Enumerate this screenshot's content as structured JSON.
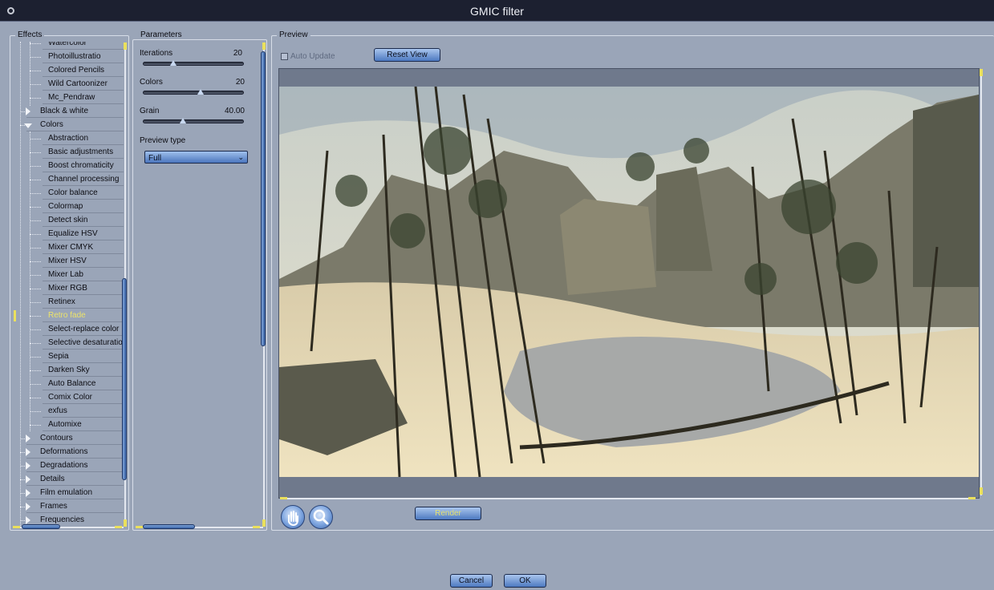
{
  "window": {
    "title": "GMIC filter"
  },
  "effects": {
    "label": "Effects",
    "items": [
      {
        "label": "Watercolor",
        "kind": "child"
      },
      {
        "label": "Photoillustratio",
        "kind": "child"
      },
      {
        "label": "Colored Pencils",
        "kind": "child"
      },
      {
        "label": "Wild Cartoonizer",
        "kind": "child"
      },
      {
        "label": "Mc_Pendraw",
        "kind": "child"
      },
      {
        "label": "Black & white",
        "kind": "parent",
        "expanded": false
      },
      {
        "label": "Colors",
        "kind": "parent",
        "expanded": true
      },
      {
        "label": "Abstraction",
        "kind": "child"
      },
      {
        "label": "Basic adjustments",
        "kind": "child"
      },
      {
        "label": "Boost chromaticity",
        "kind": "child"
      },
      {
        "label": "Channel processing",
        "kind": "child"
      },
      {
        "label": "Color balance",
        "kind": "child"
      },
      {
        "label": "Colormap",
        "kind": "child"
      },
      {
        "label": "Detect skin",
        "kind": "child"
      },
      {
        "label": "Equalize HSV",
        "kind": "child"
      },
      {
        "label": "Mixer CMYK",
        "kind": "child"
      },
      {
        "label": "Mixer HSV",
        "kind": "child"
      },
      {
        "label": "Mixer Lab",
        "kind": "child"
      },
      {
        "label": "Mixer RGB",
        "kind": "child"
      },
      {
        "label": "Retinex",
        "kind": "child"
      },
      {
        "label": "Retro fade",
        "kind": "child",
        "selected": true
      },
      {
        "label": "Select-replace color",
        "kind": "child"
      },
      {
        "label": "Selective desaturatio",
        "kind": "child"
      },
      {
        "label": "Sepia",
        "kind": "child"
      },
      {
        "label": "Darken Sky",
        "kind": "child"
      },
      {
        "label": "Auto Balance",
        "kind": "child"
      },
      {
        "label": "Comix Color",
        "kind": "child"
      },
      {
        "label": "exfus",
        "kind": "child"
      },
      {
        "label": "Automixe",
        "kind": "child"
      },
      {
        "label": "Contours",
        "kind": "parent",
        "expanded": false
      },
      {
        "label": "Deformations",
        "kind": "parent",
        "expanded": false
      },
      {
        "label": "Degradations",
        "kind": "parent",
        "expanded": false
      },
      {
        "label": "Details",
        "kind": "parent",
        "expanded": false
      },
      {
        "label": "Film emulation",
        "kind": "parent",
        "expanded": false
      },
      {
        "label": "Frames",
        "kind": "parent",
        "expanded": false
      },
      {
        "label": "Frequencies",
        "kind": "parent",
        "expanded": false
      }
    ]
  },
  "parameters": {
    "label": "Parameters",
    "iterations": {
      "label": "Iterations",
      "value": "20",
      "fraction": 0.3
    },
    "colors": {
      "label": "Colors",
      "value": "20",
      "fraction": 0.58
    },
    "grain": {
      "label": "Grain",
      "value": "40.00",
      "fraction": 0.4
    },
    "preview_type": {
      "label": "Preview type",
      "selected": "Full"
    }
  },
  "preview": {
    "label": "Preview",
    "auto_update_label": "Auto Update",
    "auto_update_checked": false,
    "reset_view_label": "Reset View",
    "render_label": "Render"
  },
  "footer": {
    "cancel_label": "Cancel",
    "ok_label": "OK"
  },
  "colors": {
    "accent": "#4d79c0",
    "highlight": "#eae05c",
    "background": "#9aa5b8"
  },
  "icons": {
    "pan": "hand-icon",
    "zoom": "magnifier-icon",
    "close": "close-icon"
  }
}
